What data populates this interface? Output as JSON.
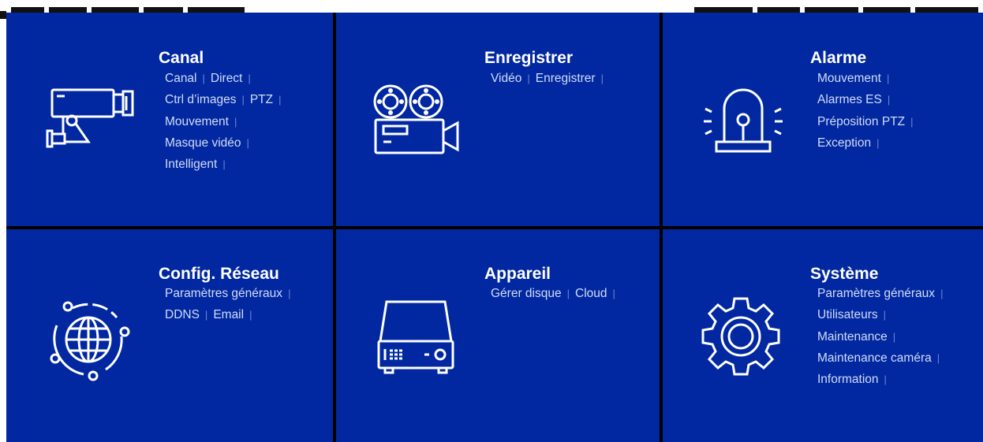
{
  "tiles": [
    {
      "title": "Canal",
      "icon": "camera-icon",
      "rows": [
        [
          "Canal",
          "Direct"
        ],
        [
          "Ctrl d’images",
          "PTZ"
        ],
        [
          "Mouvement"
        ],
        [
          "Masque vidéo"
        ],
        [
          "Intelligent"
        ]
      ]
    },
    {
      "title": "Enregistrer",
      "icon": "film-camera-icon",
      "rows": [
        [
          "Vidéo",
          "Enregistrer"
        ]
      ]
    },
    {
      "title": "Alarme",
      "icon": "alarm-siren-icon",
      "rows": [
        [
          "Mouvement"
        ],
        [
          "Alarmes ES"
        ],
        [
          "Préposition PTZ"
        ],
        [
          "Exception"
        ]
      ]
    },
    {
      "title": "Config. Réseau",
      "icon": "globe-network-icon",
      "rows": [
        [
          "Paramètres généraux"
        ],
        [
          "DDNS",
          "Email"
        ]
      ]
    },
    {
      "title": "Appareil",
      "icon": "dvr-device-icon",
      "rows": [
        [
          "Gérer disque",
          "Cloud"
        ]
      ]
    },
    {
      "title": "Système",
      "icon": "gear-icon",
      "rows": [
        [
          "Paramètres généraux"
        ],
        [
          "Utilisateurs"
        ],
        [
          "Maintenance"
        ],
        [
          "Maintenance caméra"
        ],
        [
          "Information"
        ]
      ]
    }
  ],
  "separator": "|",
  "colors": {
    "tile_bg": "#0128a1",
    "grid_gap": "#000000",
    "link_text": "#d3dcf3",
    "title_text": "#ffffff"
  }
}
